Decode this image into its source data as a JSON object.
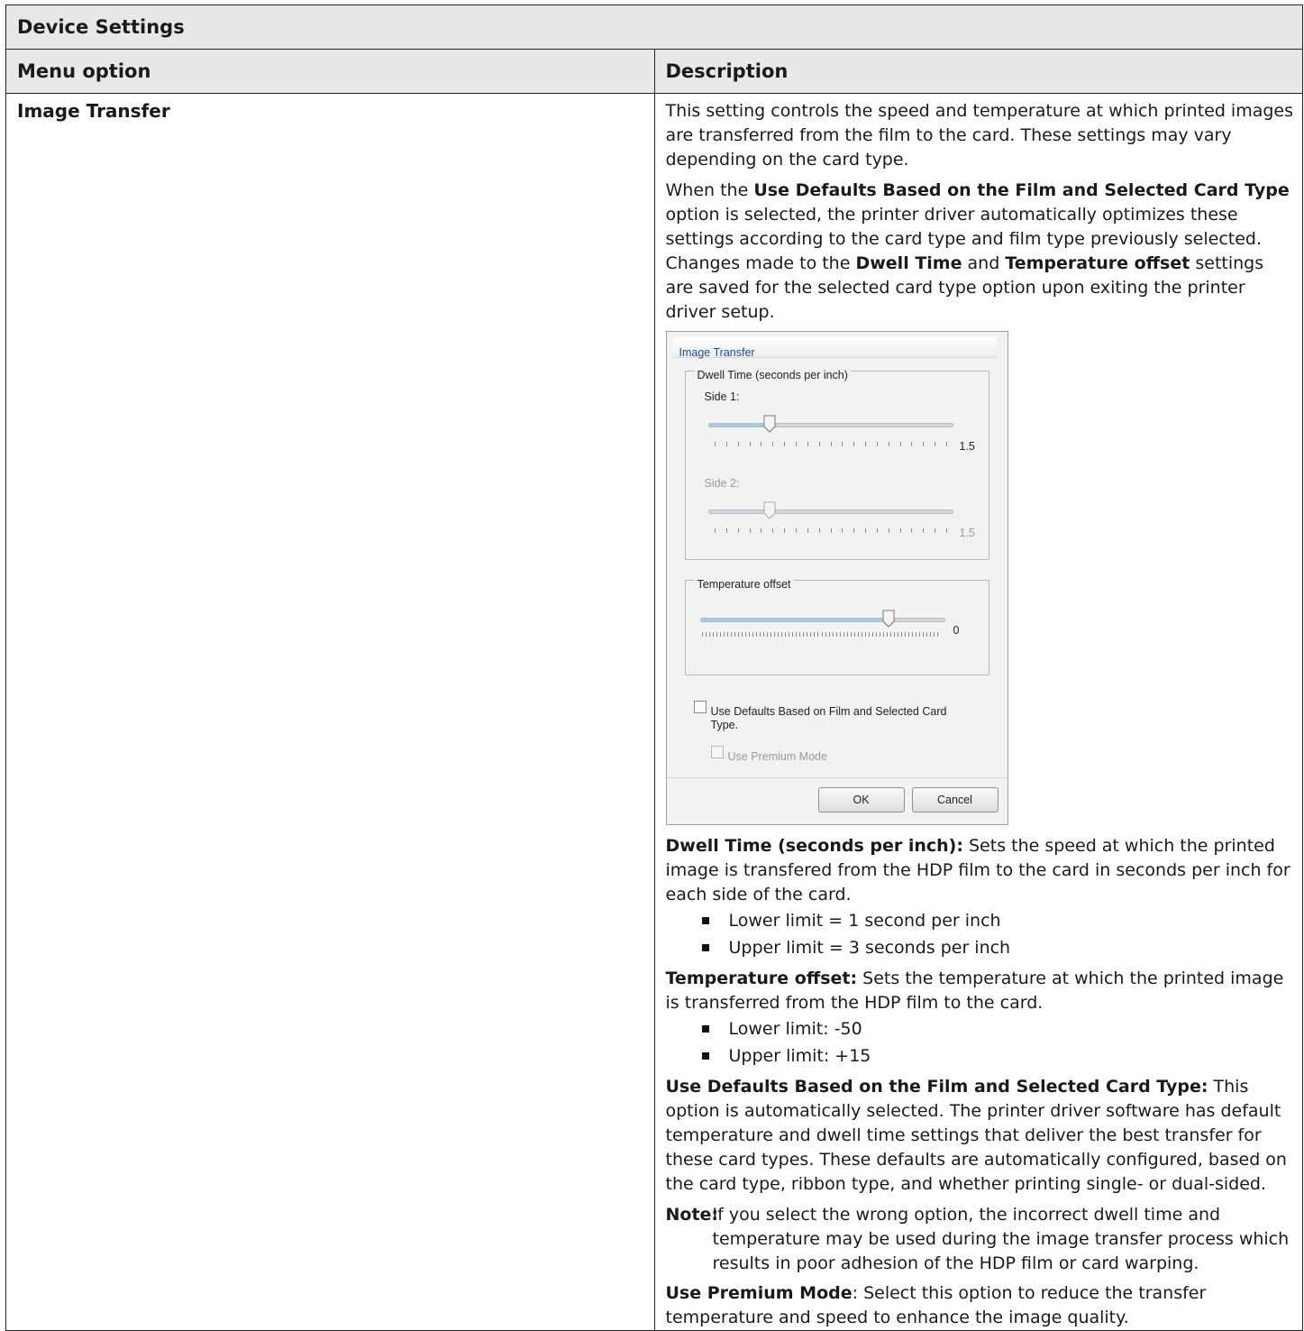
{
  "table": {
    "title": "Device Settings",
    "col_option": "Menu option",
    "col_description": "Description"
  },
  "row": {
    "option": "Image Transfer",
    "intro": "This setting controls the speed and temperature at which printed images are transferred from the film to the card. These settings may vary depending on the card type.",
    "defaults_p": {
      "t1": "When the ",
      "b1": "Use Defaults Based on the Film and Selected Card Type",
      "t2": " option is selected, the printer driver automatically optimizes these settings according to the card type and film type previously selected. Changes made to the ",
      "b2": "Dwell Time",
      "t3": " and ",
      "b3": "Temperature offset",
      "t4": " settings are saved for the selected card type option upon exiting the printer driver setup."
    },
    "dwell_p": {
      "b": "Dwell Time (seconds per inch):",
      "t": " Sets the speed at which the printed image is transfered from the HDP film to the card in seconds per inch for each side of the card."
    },
    "dwell_limits": [
      "Lower limit = 1 second per inch",
      "Upper limit = 3 seconds per inch"
    ],
    "temp_p": {
      "b": "Temperature offset:",
      "t": " Sets the temperature at which the printed image is transferred from the HDP film to the card."
    },
    "temp_limits": [
      "Lower limit: -50",
      "Upper limit: +15"
    ],
    "usedef_p": {
      "b": "Use Defaults Based on the Film and Selected Card Type:",
      "t": " This option is automatically selected. The printer driver software has default temperature and dwell time settings that deliver the best transfer for these card types. These defaults are automatically configured, based on the card type, ribbon type, and whether printing single- or dual-sided."
    },
    "note": {
      "label": "Note:",
      "text": "If you select the wrong option, the incorrect dwell time and temperature may be used during the image transfer process which results in poor adhesion of the HDP film or card warping."
    },
    "premium_p": {
      "b": "Use Premium Mode",
      "t": ": Select this option to reduce the transfer temperature and speed to enhance the image quality."
    }
  },
  "dialog": {
    "title": "Image Transfer",
    "dwell_group": "Dwell Time (seconds per inch)",
    "side1_label": "Side 1:",
    "side1_value": "1.5",
    "side1_level": 0.25,
    "side2_label": "Side 2:",
    "side2_value": "1.5",
    "side2_level": 0.25,
    "temp_group": "Temperature offset",
    "temp_value": "0",
    "temp_level": 0.77,
    "use_defaults_label_1": "Use Defaults Based on Film and Selected Card",
    "use_defaults_label_2": "Type.",
    "use_defaults_checked": false,
    "premium_label": "Use Premium Mode",
    "premium_checked": false,
    "ok_label": "OK",
    "cancel_label": "Cancel",
    "colors": {
      "title_text": "#1f4e8c",
      "slider_fill": "#9cd0ea"
    }
  }
}
